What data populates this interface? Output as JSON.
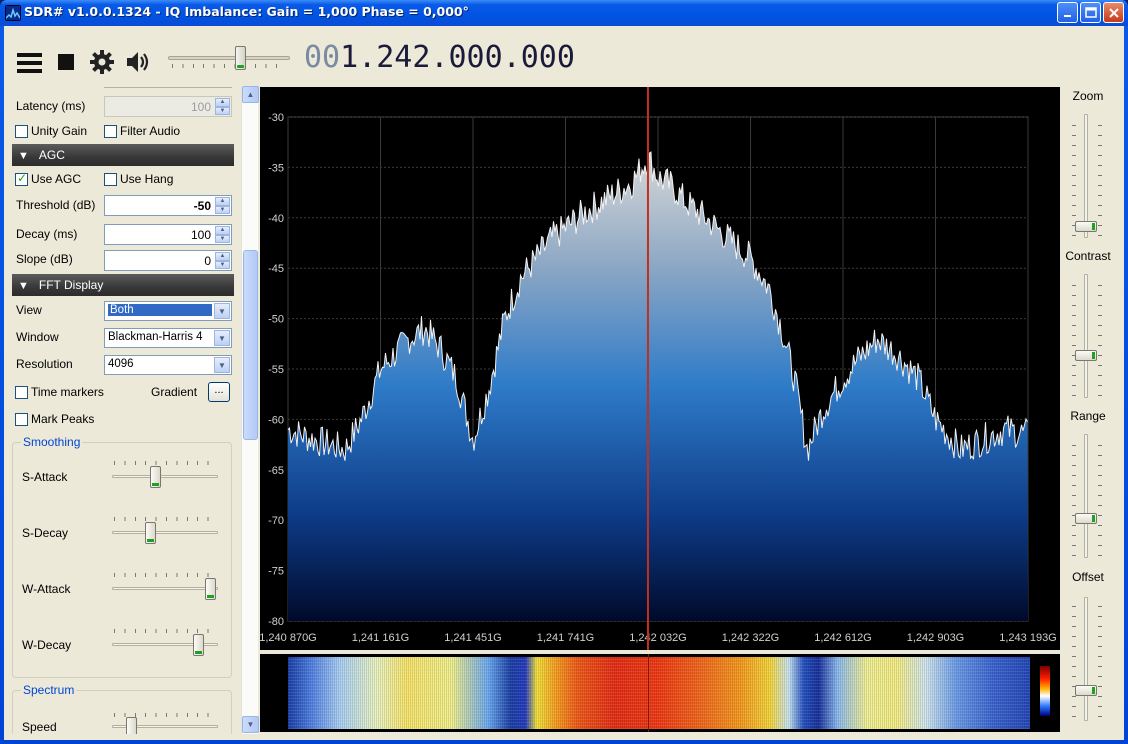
{
  "window": {
    "title": "SDR# v1.0.0.1324 - IQ Imbalance: Gain = 1,000 Phase = 0,000°"
  },
  "toolbar": {
    "icons": [
      "menu-icon",
      "stop-icon",
      "settings-gear-icon",
      "speaker-icon"
    ],
    "volume_level": 0.6,
    "frequency_prefix": "00",
    "frequency_value": "1.242.000.000"
  },
  "audio": {
    "latency_label": "Latency (ms)",
    "latency_value": "100",
    "unity_gain_label": "Unity Gain",
    "unity_gain_checked": false,
    "filter_audio_label": "Filter Audio",
    "filter_audio_checked": false
  },
  "agc": {
    "header": "AGC",
    "use_agc_label": "Use AGC",
    "use_agc_checked": true,
    "use_hang_label": "Use Hang",
    "use_hang_checked": false,
    "threshold_label": "Threshold (dB)",
    "threshold_value": "-50",
    "decay_label": "Decay (ms)",
    "decay_value": "100",
    "slope_label": "Slope (dB)",
    "slope_value": "0"
  },
  "fft": {
    "header": "FFT Display",
    "view_label": "View",
    "view_value": "Both",
    "window_label": "Window",
    "window_value": "Blackman-Harris 4",
    "resolution_label": "Resolution",
    "resolution_value": "4096",
    "time_markers_label": "Time markers",
    "time_markers_checked": false,
    "gradient_label": "Gradient",
    "gradient_button": "...",
    "mark_peaks_label": "Mark Peaks",
    "mark_peaks_checked": false,
    "smoothing_title": "Smoothing",
    "s_attack_label": "S-Attack",
    "s_attack_level": 0.4,
    "s_decay_label": "S-Decay",
    "s_decay_level": 0.35,
    "w_attack_label": "W-Attack",
    "w_attack_level": 0.98,
    "w_decay_label": "W-Decay",
    "w_decay_level": 0.85,
    "spectrum_title": "Spectrum",
    "speed_label": "Speed",
    "speed_level": 0.15
  },
  "right_controls": {
    "zoom_label": "Zoom",
    "zoom_level": 0.05,
    "contrast_label": "Contrast",
    "contrast_level": 0.33,
    "range_label": "Range",
    "range_level": 0.3,
    "offset_label": "Offset",
    "offset_level": 0.22
  },
  "chart_data": {
    "type": "area",
    "title": "",
    "xlabel": "",
    "ylabel": "",
    "x_tick_labels": [
      "1,240 870G",
      "1,241 161G",
      "1,241 451G",
      "1,241 741G",
      "1,242 032G",
      "1,242 322G",
      "1,242 612G",
      "1,242 903G",
      "1,243 193G"
    ],
    "y_tick_labels": [
      "-30",
      "-35",
      "-40",
      "-45",
      "-50",
      "-55",
      "-60",
      "-65",
      "-70",
      "-75",
      "-80"
    ],
    "ylim": [
      -80,
      -30
    ],
    "xlim_mhz": [
      1240.87,
      1243.193
    ],
    "tuned_frequency_mhz": 1242.0,
    "grid": true,
    "series": [
      {
        "x_mhz": [
          1240.87,
          1240.95,
          1241.05,
          1241.1,
          1241.161,
          1241.25,
          1241.3,
          1241.35,
          1241.4,
          1241.451,
          1241.5,
          1241.55,
          1241.6,
          1241.65,
          1241.7,
          1241.741,
          1241.8,
          1241.85,
          1241.9,
          1241.95,
          1242.0,
          1242.032,
          1242.08,
          1242.12,
          1242.18,
          1242.25,
          1242.322,
          1242.38,
          1242.42,
          1242.46,
          1242.5,
          1242.55,
          1242.612,
          1242.66,
          1242.72,
          1242.78,
          1242.85,
          1242.903,
          1242.98,
          1243.05,
          1243.12,
          1243.193
        ],
        "values": [
          -61,
          -62,
          -63,
          -60,
          -55,
          -52,
          -51,
          -53,
          -56,
          -62,
          -57,
          -50,
          -46,
          -44,
          -42,
          -41,
          -39.5,
          -38.5,
          -37.5,
          -36.5,
          -34,
          -36,
          -37,
          -38.5,
          -40,
          -42,
          -44,
          -47,
          -51,
          -56,
          -63,
          -59,
          -56,
          -54,
          -52,
          -53.5,
          -56,
          -60,
          -63,
          -62,
          -61,
          -61.5
        ]
      }
    ]
  }
}
